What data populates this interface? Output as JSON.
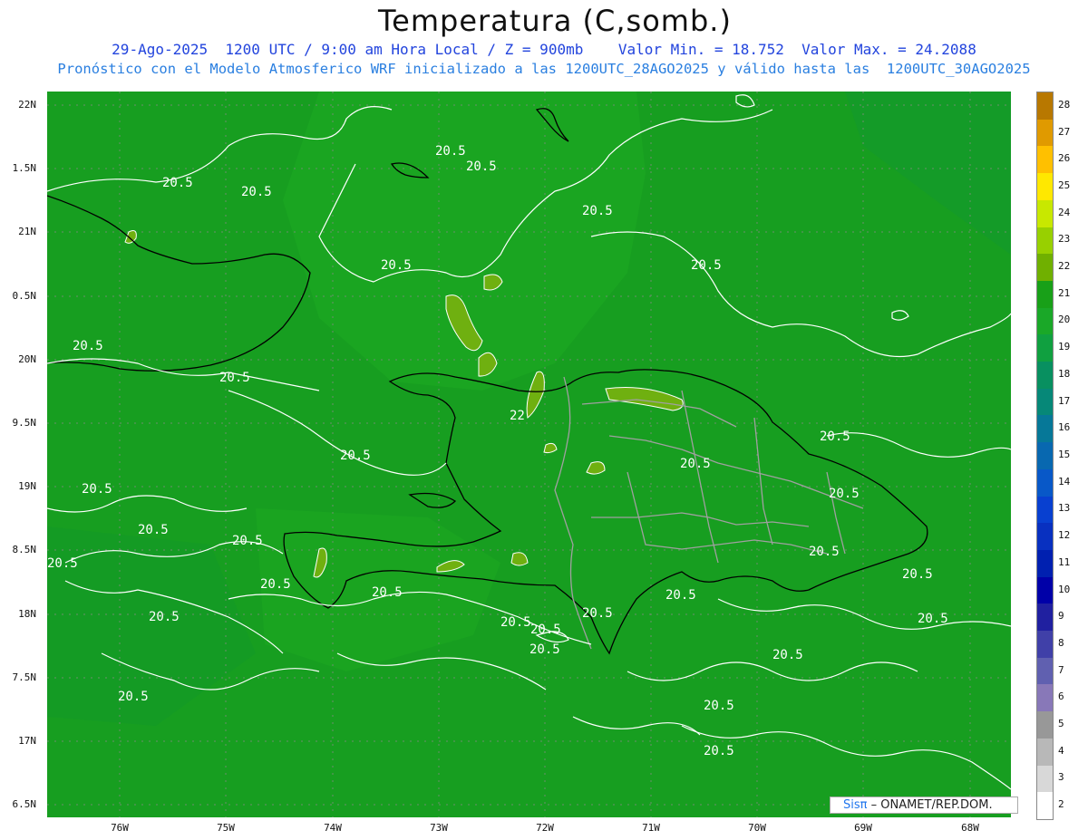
{
  "title": "Temperatura (C,somb.)",
  "subtitle1": "29-Ago-2025  1200 UTC / 9:00 am Hora Local / Z = 900mb    Valor Min. = 18.752  Valor Max. = 24.2088",
  "subtitle2": "Pronóstico con el Modelo Atmosferico WRF inicializado a las 1200UTC_28AGO2025 y válido hasta las  1200UTC_30AGO2025",
  "credit": {
    "sis": "Sisπ",
    "rest": "– ONAMET/REP.DOM."
  },
  "lat_labels": [
    "22N",
    "1.5N",
    "21N",
    "0.5N",
    "20N",
    "9.5N",
    "19N",
    "8.5N",
    "18N",
    "7.5N",
    "17N",
    "6.5N"
  ],
  "lon_labels": [
    "76W",
    "75W",
    "74W",
    "73W",
    "72W",
    "71W",
    "70W",
    "69W",
    "68W"
  ],
  "colorbar": {
    "levels": [
      "28",
      "27",
      "26",
      "25",
      "24",
      "23",
      "22",
      "21",
      "20",
      "19",
      "18",
      "17",
      "16",
      "15",
      "14",
      "13",
      "12",
      "11",
      "10",
      "9",
      "8",
      "7",
      "6",
      "5",
      "4",
      "3",
      "2"
    ],
    "colors": [
      "#b87800",
      "#e09a00",
      "#ffc000",
      "#ffe800",
      "#c8e800",
      "#98d000",
      "#70b000",
      "#18a018",
      "#1aa828",
      "#10a040",
      "#089060",
      "#068878",
      "#067898",
      "#0868b0",
      "#0858c8",
      "#0840d0",
      "#0830c0",
      "#0020b0",
      "#0000a8",
      "#2020a0",
      "#4040a8",
      "#6060b0",
      "#8878b8",
      "#989898",
      "#b8b8b8",
      "#d8d8d8",
      "#ffffff"
    ]
  },
  "contour_labels": [
    "20.5",
    "20.5",
    "20.5",
    "20.5",
    "20.5",
    "20.5",
    "20.5",
    "20.5",
    "20.5",
    "22",
    "20.5",
    "20.5",
    "20.5",
    "20.5",
    "20.5",
    "20.5",
    "20.5",
    "20.5",
    "20.5",
    "20.5",
    "20.5",
    "20.5",
    "20.5",
    "20.5",
    "20.5",
    "20.5",
    "20.5",
    "20.5",
    "20.5",
    "20.5",
    "20.5",
    "20.5",
    "20.5"
  ]
}
